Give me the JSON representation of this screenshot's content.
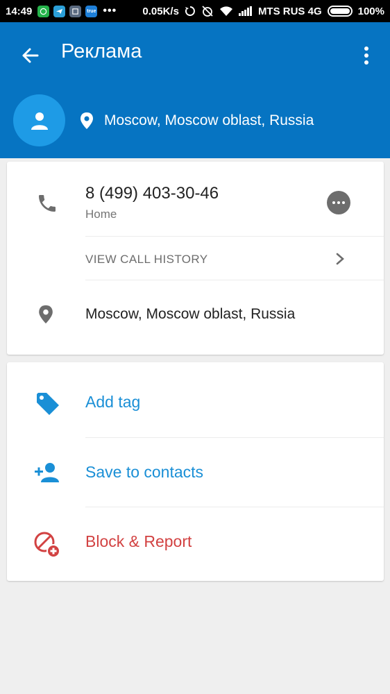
{
  "status_bar": {
    "time": "14:49",
    "app_true_label": "true",
    "more_dots": "•••",
    "net_speed": "0.05K/s",
    "carrier": "MTS RUS 4G",
    "battery": "100%"
  },
  "app_bar": {
    "title": "Реклама",
    "location": "Moscow, Moscow oblast, Russia",
    "color": "#0674c2"
  },
  "contact": {
    "phone_number": "8 (499) 403-30-46",
    "phone_label": "Home",
    "view_call_history": "VIEW CALL HISTORY",
    "address": "Moscow, Moscow oblast, Russia"
  },
  "actions": {
    "add_tag": "Add tag",
    "save_to_contacts": "Save to contacts",
    "block_report": "Block & Report"
  },
  "colors": {
    "accent": "#1a8fd6",
    "danger": "#d24242"
  }
}
